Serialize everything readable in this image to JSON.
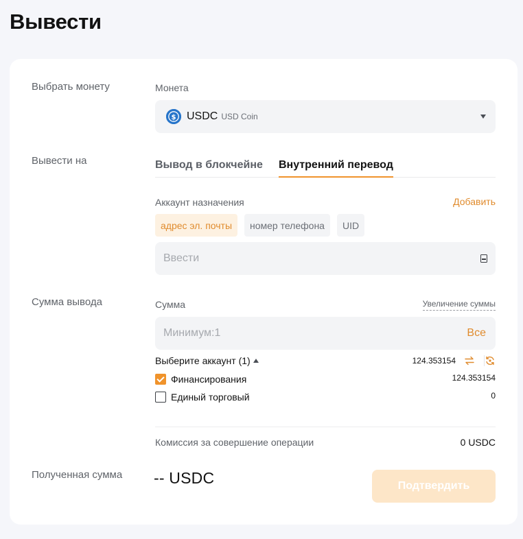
{
  "page_title": "Вывести",
  "coin": {
    "section_label": "Выбрать монету",
    "field_label": "Монета",
    "symbol": "USDC",
    "name": "USD Coin",
    "icon": "usdc-coin-icon",
    "icon_glyph": "$"
  },
  "withdraw_to": {
    "section_label": "Вывести на",
    "tabs": [
      {
        "label": "Вывод в блокчейне",
        "active": false
      },
      {
        "label": "Внутренний перевод",
        "active": true
      }
    ],
    "dest_label": "Аккаунт назначения",
    "add_label": "Добавить",
    "chips": [
      {
        "label": "адрес эл. почты",
        "active": true
      },
      {
        "label": "номер телефона",
        "active": false
      },
      {
        "label": "UID",
        "active": false
      }
    ],
    "input_placeholder": "Ввести"
  },
  "amount": {
    "section_label": "Сумма вывода",
    "field_label": "Сумма",
    "increase_label": "Увеличение суммы",
    "input_placeholder": "Минимум:1",
    "all_label": "Все",
    "account_select_label": "Выберите аккаунт (1)",
    "total_balance": "124.353154",
    "accounts": [
      {
        "name": "Финансирования",
        "balance": "124.353154",
        "checked": true
      },
      {
        "name": "Единый торговый",
        "balance": "0",
        "checked": false
      }
    ],
    "fee_label": "Комиссия за совершение операции",
    "fee_value": "0 USDC"
  },
  "received": {
    "section_label": "Полученная сумма",
    "value": "-- USDC",
    "confirm_label": "Подтвердить"
  },
  "colors": {
    "accent": "#f0932b",
    "accent_text": "#e08b2d",
    "confirm_disabled_bg": "#fde6c8",
    "usdc_blue": "#2775ca"
  }
}
